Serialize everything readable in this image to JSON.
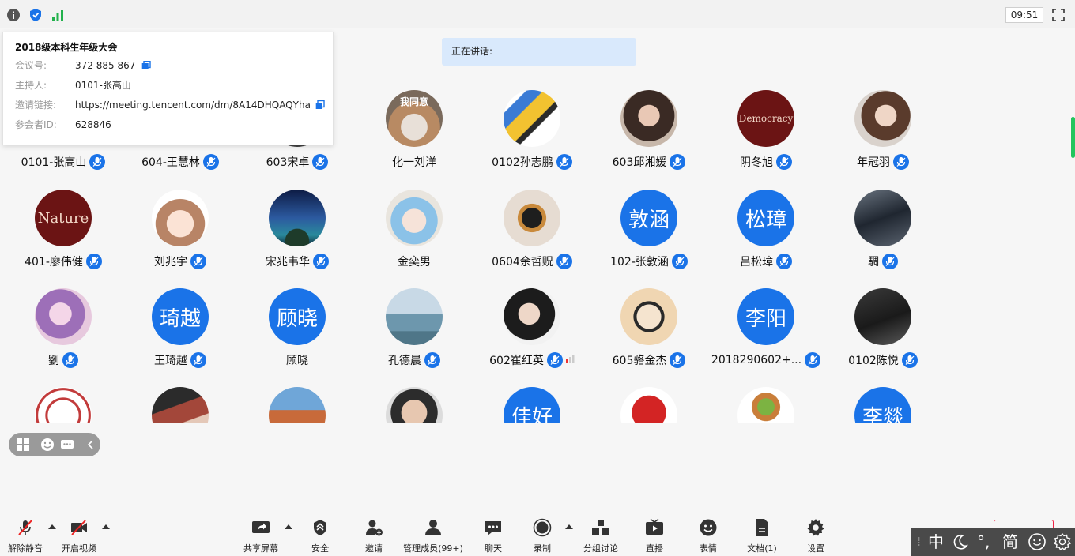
{
  "topbar": {
    "time": "09:51"
  },
  "info": {
    "title": "2018级本科生年级大会",
    "rows": [
      {
        "key": "会议号:",
        "value": "372 885 867"
      },
      {
        "key": "主持人:",
        "value": "0101-张高山"
      },
      {
        "key": "邀请链接:",
        "value": "https://meeting.tencent.com/dm/8A14DHQAQYha"
      },
      {
        "key": "参会者ID:",
        "value": "628846"
      }
    ]
  },
  "speaking": {
    "label": "正在讲话:"
  },
  "participants": [
    {
      "name": "0101-张高山",
      "avatar": "hidden",
      "mic": true
    },
    {
      "name": "604-王慧林",
      "avatar": "hidden",
      "mic": true
    },
    {
      "name": "603宋卓",
      "avatar": "photo-boy",
      "mic": true
    },
    {
      "name": "化一刘洋",
      "avatar": "photo-cat",
      "avatar_text": "我同意",
      "mic": false
    },
    {
      "name": "0102孙志鹏",
      "avatar": "photo-graffiti",
      "mic": true
    },
    {
      "name": "603邱湘媛",
      "avatar": "photo-girl",
      "mic": true
    },
    {
      "name": "阴冬旭",
      "avatar": "word",
      "avatar_text": "Democracy",
      "mic": true
    },
    {
      "name": "年冠羽",
      "avatar": "photo-girl2",
      "mic": true
    },
    {
      "name": "401-廖伟健",
      "avatar": "word",
      "avatar_text": "Nature",
      "mic": true
    },
    {
      "name": "刘兆宇",
      "avatar": "photo-anime",
      "mic": true
    },
    {
      "name": "宋兆韦华",
      "avatar": "photo-galaxy",
      "mic": true
    },
    {
      "name": "金奕男",
      "avatar": "photo-anime2",
      "mic": false
    },
    {
      "name": "0604余哲贶",
      "avatar": "photo-penguin",
      "mic": true
    },
    {
      "name": "102-张敦涵",
      "avatar": "text",
      "avatar_text": "敦涵",
      "mic": true
    },
    {
      "name": "吕松璋",
      "avatar": "text",
      "avatar_text": "松璋",
      "mic": true
    },
    {
      "name": "騆",
      "avatar": "photo-dark",
      "mic": true
    },
    {
      "name": "劉",
      "avatar": "photo-purple",
      "mic": true
    },
    {
      "name": "王琦越",
      "avatar": "text",
      "avatar_text": "琦越",
      "mic": true
    },
    {
      "name": "顾晓",
      "avatar": "text",
      "avatar_text": "顾晓",
      "mic": false
    },
    {
      "name": "孔德晨",
      "avatar": "photo-sea",
      "mic": true
    },
    {
      "name": "602崔红英",
      "avatar": "photo-woman",
      "mic": true,
      "signal": true
    },
    {
      "name": "605骆金杰",
      "avatar": "photo-manga",
      "mic": true
    },
    {
      "name": "2018290602+...",
      "avatar": "text",
      "avatar_text": "李阳",
      "mic": true
    },
    {
      "name": "0102陈悦",
      "avatar": "photo-dark2",
      "mic": true
    },
    {
      "name": "",
      "avatar": "photo-seal",
      "mic": false
    },
    {
      "name": "",
      "avatar": "photo-room",
      "mic": false
    },
    {
      "name": "",
      "avatar": "photo-arch",
      "mic": false
    },
    {
      "name": "",
      "avatar": "photo-face",
      "mic": false
    },
    {
      "name": "",
      "avatar": "text",
      "avatar_text": "佳好",
      "mic": false
    },
    {
      "name": "",
      "avatar": "photo-pixel",
      "mic": false
    },
    {
      "name": "",
      "avatar": "photo-figure",
      "mic": false
    },
    {
      "name": "",
      "avatar": "text",
      "avatar_text": "李燚",
      "mic": false
    }
  ],
  "toolbar": {
    "unmute": "解除静音",
    "video": "开启视频",
    "share": "共享屏幕",
    "security": "安全",
    "invite": "邀请",
    "members": "管理成员(99+)",
    "chat": "聊天",
    "record": "录制",
    "breakout": "分组讨论",
    "live": "直播",
    "reactions": "表情",
    "docs": "文档(1)",
    "settings": "设置"
  },
  "ime": {
    "mode": "中",
    "punct": "°,",
    "script": "简"
  },
  "colors": {
    "accent": "#1a73e8",
    "speaking_bg": "#d9e9fc"
  }
}
